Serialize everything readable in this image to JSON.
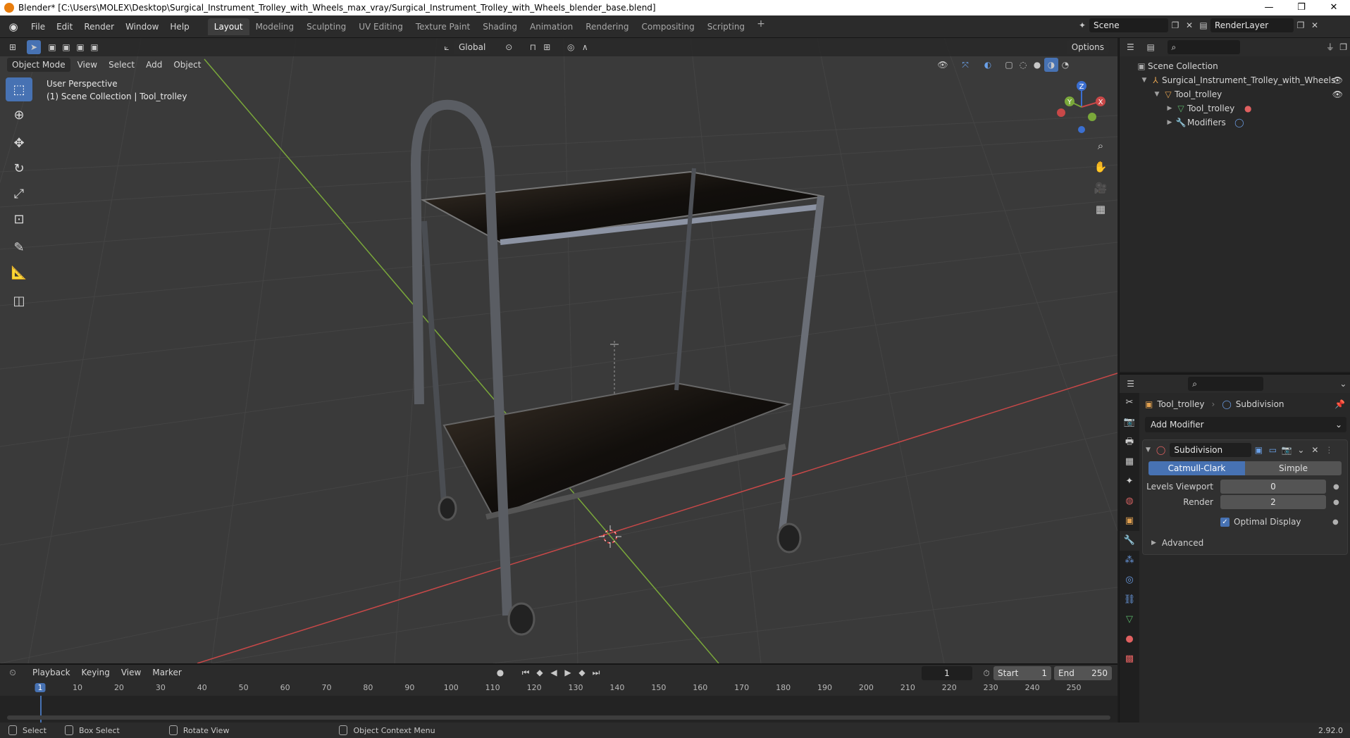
{
  "window": {
    "title": "Blender* [C:\\Users\\MOLEX\\Desktop\\Surgical_Instrument_Trolley_with_Wheels_max_vray/Surgical_Instrument_Trolley_with_Wheels_blender_base.blend]",
    "minimize": "—",
    "maximize": "❐",
    "close": "✕"
  },
  "menu": [
    "File",
    "Edit",
    "Render",
    "Window",
    "Help"
  ],
  "workspaces": [
    "Layout",
    "Modeling",
    "Sculpting",
    "UV Editing",
    "Texture Paint",
    "Shading",
    "Animation",
    "Rendering",
    "Compositing",
    "Scripting"
  ],
  "active_workspace": "Layout",
  "scene": {
    "name": "Scene",
    "render_layer": "RenderLayer"
  },
  "viewport": {
    "mode": "Object Mode",
    "menus": [
      "View",
      "Select",
      "Add",
      "Object"
    ],
    "transform_orientation": "Global",
    "options_label": "Options",
    "perspective": "User Perspective",
    "collection_info": "(1) Scene Collection | Tool_trolley",
    "gizmo_axes": {
      "x": "X",
      "y": "Y",
      "z": "Z"
    }
  },
  "outliner": {
    "root": "Scene Collection",
    "items": [
      {
        "label": "Surgical_Instrument_Trolley_with_Wheels",
        "depth": 1
      },
      {
        "label": "Tool_trolley",
        "depth": 2
      },
      {
        "label": "Tool_trolley",
        "depth": 3
      },
      {
        "label": "Modifiers",
        "depth": 3
      }
    ]
  },
  "properties": {
    "object": "Tool_trolley",
    "modifier_breadcrumb": "Subdivision",
    "add_modifier": "Add Modifier",
    "modifier": {
      "name": "Subdivision",
      "mode_a": "Catmull-Clark",
      "mode_b": "Simple",
      "levels_viewport_label": "Levels Viewport",
      "levels_viewport": "0",
      "render_label": "Render",
      "render": "2",
      "optimal_display": "Optimal Display",
      "advanced": "Advanced"
    }
  },
  "timeline": {
    "menus": [
      "Playback",
      "Keying",
      "View",
      "Marker"
    ],
    "current_frame": "1",
    "start_label": "Start",
    "start": "1",
    "end_label": "End",
    "end": "250",
    "ticks": [
      "1",
      "10",
      "20",
      "30",
      "40",
      "50",
      "60",
      "70",
      "80",
      "90",
      "100",
      "110",
      "120",
      "130",
      "140",
      "150",
      "160",
      "170",
      "180",
      "190",
      "200",
      "210",
      "220",
      "230",
      "240",
      "250"
    ]
  },
  "statusbar": {
    "select": "Select",
    "box_select": "Box Select",
    "rotate_view": "Rotate View",
    "context_menu": "Object Context Menu",
    "version": "2.92.0"
  },
  "colors": {
    "accent": "#4772b3",
    "axis_x": "#c84848",
    "axis_y": "#7aa83a",
    "axis_z": "#3b6fd1"
  }
}
